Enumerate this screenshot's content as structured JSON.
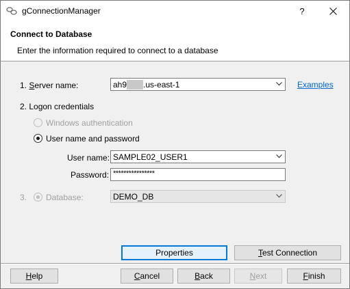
{
  "window": {
    "title": "gConnectionManager",
    "help_glyph": "?",
    "close_glyph": "✕",
    "icon": "app-connection-icon"
  },
  "header": {
    "title": "Connect to Database",
    "description": "Enter the information required to connect to a database"
  },
  "server": {
    "label_prefix": "1. ",
    "label_access": "S",
    "label_rest": "erver name:",
    "value_prefix": "ah9",
    "value_suffix": ".us-east-1",
    "examples_link": "Examples"
  },
  "logon": {
    "label": "2. Logon credentials",
    "windows_auth": {
      "label": "Windows authentication",
      "selected": false,
      "enabled": false
    },
    "user_pass": {
      "label": "User name and password",
      "selected": true,
      "enabled": true
    },
    "username_label": "User name:",
    "username_value": "SAMPLE02_USER1",
    "password_label": "Password:",
    "password_value": "****************"
  },
  "database": {
    "number": "3.",
    "label": "Database:",
    "value": "DEMO_DB",
    "enabled": false
  },
  "buttons": {
    "properties": "Properties",
    "test_connection_access": "T",
    "test_connection_rest": "est Connection",
    "help_access": "H",
    "help_rest": "elp",
    "cancel_access": "C",
    "cancel_rest": "ancel",
    "back_access": "B",
    "back_rest": "ack",
    "next_access": "N",
    "next_rest": "ext",
    "finish_access": "F",
    "finish_rest": "inish"
  },
  "colors": {
    "link": "#0066cc",
    "accent": "#0078d7",
    "disabled_text": "#a0a0a0"
  }
}
